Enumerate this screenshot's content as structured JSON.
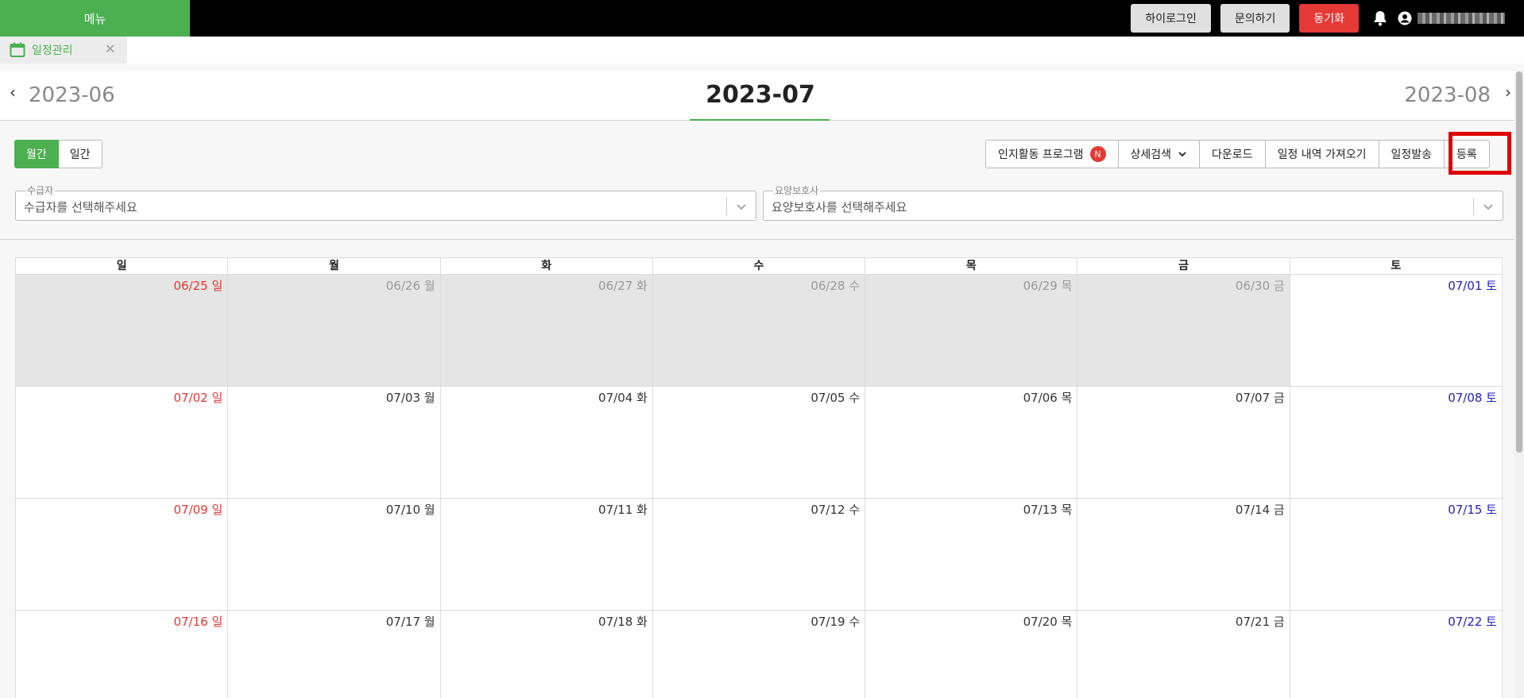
{
  "topbar": {
    "menu_label": "메뉴",
    "hiloginLabel": "하이로그인",
    "inquiry_label": "문의하기",
    "sync_label": "동기화",
    "icons": [
      "bell-icon",
      "user-circle-icon"
    ],
    "colors": {
      "accent": "#4caf50",
      "danger": "#e53935",
      "bar": "#000000"
    }
  },
  "tabs": [
    {
      "label": "일정관리",
      "icon": "calendar-icon"
    }
  ],
  "month_nav": {
    "prev": "2023-06",
    "current": "2023-07",
    "next": "2023-08"
  },
  "view_toggle": {
    "monthly": "월간",
    "daily": "일간",
    "active": "월간"
  },
  "actions": {
    "cognitive_program": "인지활동 프로그램",
    "cognitive_badge": "N",
    "detail_search": "상세검색",
    "download": "다운로드",
    "import_schedule": "일정 내역 가져오기",
    "send_schedule": "일정발송",
    "register": "등록"
  },
  "filters": {
    "recipient": {
      "legend": "수급자",
      "placeholder": "수급자를 선택해주세요"
    },
    "caregiver": {
      "legend": "요양보호사",
      "placeholder": "요양보호사를 선택해주세요"
    }
  },
  "calendar": {
    "weekdays": [
      "일",
      "월",
      "화",
      "수",
      "목",
      "금",
      "토"
    ],
    "weeks": [
      [
        {
          "label": "06/25 일",
          "outside": true
        },
        {
          "label": "06/26 월",
          "outside": true
        },
        {
          "label": "06/27 화",
          "outside": true
        },
        {
          "label": "06/28 수",
          "outside": true
        },
        {
          "label": "06/29 목",
          "outside": true
        },
        {
          "label": "06/30 금",
          "outside": true
        },
        {
          "label": "07/01 토",
          "outside": false
        }
      ],
      [
        {
          "label": "07/02 일",
          "outside": false
        },
        {
          "label": "07/03 월",
          "outside": false
        },
        {
          "label": "07/04 화",
          "outside": false
        },
        {
          "label": "07/05 수",
          "outside": false
        },
        {
          "label": "07/06 목",
          "outside": false
        },
        {
          "label": "07/07 금",
          "outside": false
        },
        {
          "label": "07/08 토",
          "outside": false
        }
      ],
      [
        {
          "label": "07/09 일",
          "outside": false
        },
        {
          "label": "07/10 월",
          "outside": false
        },
        {
          "label": "07/11 화",
          "outside": false
        },
        {
          "label": "07/12 수",
          "outside": false
        },
        {
          "label": "07/13 목",
          "outside": false
        },
        {
          "label": "07/14 금",
          "outside": false
        },
        {
          "label": "07/15 토",
          "outside": false
        }
      ],
      [
        {
          "label": "07/16 일",
          "outside": false
        },
        {
          "label": "07/17 월",
          "outside": false
        },
        {
          "label": "07/18 화",
          "outside": false
        },
        {
          "label": "07/19 수",
          "outside": false
        },
        {
          "label": "07/20 목",
          "outside": false
        },
        {
          "label": "07/21 금",
          "outside": false
        },
        {
          "label": "07/22 토",
          "outside": false
        }
      ]
    ]
  }
}
